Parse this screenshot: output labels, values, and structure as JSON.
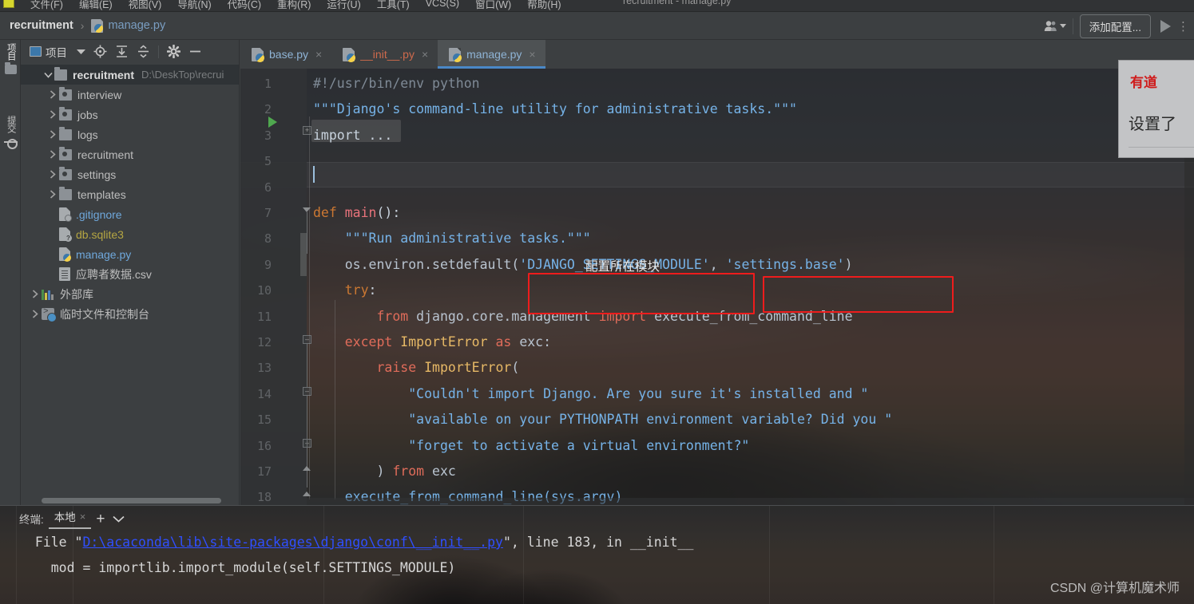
{
  "window": {
    "title": "recruitment - manage.py",
    "app_icon": "pycharm-icon"
  },
  "menubar": {
    "items": [
      {
        "label": "文件(F)"
      },
      {
        "label": "编辑(E)"
      },
      {
        "label": "视图(V)"
      },
      {
        "label": "导航(N)"
      },
      {
        "label": "代码(C)"
      },
      {
        "label": "重构(R)"
      },
      {
        "label": "运行(U)"
      },
      {
        "label": "工具(T)"
      },
      {
        "label": "VCS(S)"
      },
      {
        "label": "窗口(W)"
      },
      {
        "label": "帮助(H)"
      }
    ]
  },
  "navbar": {
    "breadcrumb": {
      "project": "recruitment",
      "separator": "›",
      "file": "manage.py"
    },
    "add_config_label": "添加配置...",
    "more_label": "⋮"
  },
  "toolstrip": {
    "tabs": [
      {
        "label": "项目",
        "icon": "folder-icon",
        "active": true
      },
      {
        "label": "提交",
        "icon": "commit-icon",
        "active": false
      }
    ]
  },
  "project_panel": {
    "title": "项目",
    "toolbar_icons": [
      "locate-icon",
      "expand-all-icon",
      "collapse-all-icon",
      "gear-icon",
      "hide-icon"
    ],
    "tree": [
      {
        "label": "recruitment",
        "path": "D:\\DeskTop\\recrui",
        "kind": "root",
        "depth": 0,
        "expanded": true
      },
      {
        "label": "interview",
        "kind": "module",
        "depth": 1,
        "expanded": false
      },
      {
        "label": "jobs",
        "kind": "module",
        "depth": 1,
        "expanded": false
      },
      {
        "label": "logs",
        "kind": "folder",
        "depth": 1,
        "expanded": false
      },
      {
        "label": "recruitment",
        "kind": "module",
        "depth": 1,
        "expanded": false
      },
      {
        "label": "settings",
        "kind": "module",
        "depth": 1,
        "expanded": false
      },
      {
        "label": "templates",
        "kind": "folder",
        "depth": 1,
        "expanded": false
      },
      {
        "label": ".gitignore",
        "kind": "ignored-file",
        "depth": 1
      },
      {
        "label": "db.sqlite3",
        "kind": "unknown-file",
        "depth": 1
      },
      {
        "label": "manage.py",
        "kind": "python-file",
        "depth": 1
      },
      {
        "label": "应聘者数据.csv",
        "kind": "csv-file",
        "depth": 1
      },
      {
        "label": "外部库",
        "kind": "library",
        "depth": 0,
        "expanded": false
      },
      {
        "label": "临时文件和控制台",
        "kind": "scratches",
        "depth": 0,
        "expanded": false
      }
    ]
  },
  "editor": {
    "tabs": [
      {
        "label": "base.py",
        "color": "blue",
        "active": false
      },
      {
        "label": "__init__.py",
        "color": "red",
        "active": false
      },
      {
        "label": "manage.py",
        "color": "blue",
        "active": true
      }
    ],
    "close_glyph": "×",
    "current_line": 6,
    "lines": [
      {
        "n": "1",
        "runnable": true,
        "tokens": [
          {
            "t": "#!/usr/bin/env python",
            "c": "c-comment"
          }
        ]
      },
      {
        "n": "2",
        "tokens": [
          {
            "t": "\"\"\"Django's command-line utility for administrative tasks.\"\"\"",
            "c": "c-string"
          }
        ]
      },
      {
        "n": "3",
        "folded": true,
        "tokens": [
          {
            "t": "import ...",
            "c": "c-plain"
          }
        ]
      },
      {
        "n": "5",
        "tokens": []
      },
      {
        "n": "6",
        "tokens": []
      },
      {
        "n": "7",
        "tokens": [
          {
            "t": "def ",
            "c": "c-kw"
          },
          {
            "t": "main",
            "c": "c-def"
          },
          {
            "t": "():",
            "c": "c-plain"
          }
        ]
      },
      {
        "n": "8",
        "tokens": [
          {
            "t": "    \"\"\"Run administrative tasks.\"\"\"",
            "c": "c-string"
          }
        ]
      },
      {
        "n": "9",
        "tokens": [
          {
            "t": "    os.environ.setdefault(",
            "c": "c-ident"
          },
          {
            "t": "'DJANGO_SETTINGS_MODULE'",
            "c": "c-string"
          },
          {
            "t": ", ",
            "c": "c-ident"
          },
          {
            "t": "'settings.base'",
            "c": "c-string"
          },
          {
            "t": ")",
            "c": "c-ident"
          }
        ]
      },
      {
        "n": "10",
        "tokens": [
          {
            "t": "    try",
            "c": "c-kw"
          },
          {
            "t": ":",
            "c": "c-plain"
          }
        ]
      },
      {
        "n": "11",
        "tokens": [
          {
            "t": "        from ",
            "c": "c-kw2"
          },
          {
            "t": "django.core.management ",
            "c": "c-ident"
          },
          {
            "t": "import ",
            "c": "c-kw2"
          },
          {
            "t": "execute_from_command_line",
            "c": "c-ident"
          }
        ]
      },
      {
        "n": "12",
        "tokens": [
          {
            "t": "    except ",
            "c": "c-kw2"
          },
          {
            "t": "ImportError ",
            "c": "c-class"
          },
          {
            "t": "as ",
            "c": "c-kw2"
          },
          {
            "t": "exc:",
            "c": "c-ident"
          }
        ]
      },
      {
        "n": "13",
        "tokens": [
          {
            "t": "        raise ",
            "c": "c-kw2"
          },
          {
            "t": "ImportError",
            "c": "c-class"
          },
          {
            "t": "(",
            "c": "c-ident"
          }
        ]
      },
      {
        "n": "14",
        "tokens": [
          {
            "t": "            \"Couldn't import Django. Are you sure it's installed and \"",
            "c": "c-string"
          }
        ]
      },
      {
        "n": "15",
        "tokens": [
          {
            "t": "            \"available on your PYTHONPATH environment variable? Did you \"",
            "c": "c-string"
          }
        ]
      },
      {
        "n": "16",
        "tokens": [
          {
            "t": "            \"forget to activate a virtual environment?\"",
            "c": "c-string"
          }
        ]
      },
      {
        "n": "17",
        "tokens": [
          {
            "t": "        ) ",
            "c": "c-ident"
          },
          {
            "t": "from ",
            "c": "c-kw2"
          },
          {
            "t": "exc",
            "c": "c-ident"
          }
        ]
      },
      {
        "n": "18",
        "tokens": [
          {
            "t": "    execute_from_command_line(sys.argv)",
            "c": "c-string"
          }
        ]
      }
    ],
    "annotations": [
      {
        "type": "label",
        "text": "配置所在模块"
      },
      {
        "type": "box",
        "name": "settings-module-key-box"
      },
      {
        "type": "box",
        "name": "settings-module-value-box"
      }
    ]
  },
  "terminal": {
    "label": "终端:",
    "tab": "本地",
    "close_glyph": "×",
    "plus_glyph": "+",
    "chevron_glyph": "⌄",
    "output": [
      {
        "prefix": "  File \"",
        "link": "D:\\acaconda\\lib\\site-packages\\django\\conf\\__init__.py",
        "suffix": "\", line 183, in __init__"
      },
      {
        "plain": "    mod = importlib.import_module(self.SETTINGS_MODULE)"
      }
    ]
  },
  "watermark": "CSDN @计算机魔术师",
  "youdao": {
    "logo": "有道",
    "text": "设置了"
  },
  "colors": {
    "accent_blue": "#4a88c7",
    "annotation_red": "#ee1c1c",
    "run_green": "#4fa84f",
    "tab_active_bg": "#4e5254",
    "panel_bg": "#3c3f41",
    "editor_bg": "#2b2b2b",
    "link_blue": "#2f4fff",
    "youdao_red": "#cf1b1b"
  }
}
